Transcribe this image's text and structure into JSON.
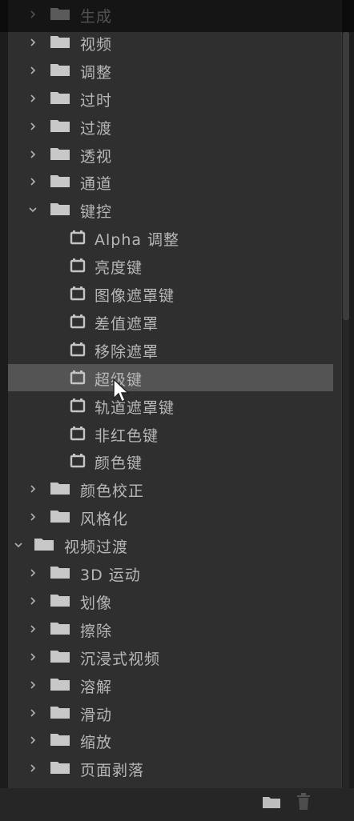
{
  "tree": {
    "items": [
      {
        "label": "生成",
        "state": "collapsed",
        "type": "folder",
        "level": 1
      },
      {
        "label": "视频",
        "state": "collapsed",
        "type": "folder",
        "level": 1
      },
      {
        "label": "调整",
        "state": "collapsed",
        "type": "folder",
        "level": 1
      },
      {
        "label": "过时",
        "state": "collapsed",
        "type": "folder",
        "level": 1
      },
      {
        "label": "过渡",
        "state": "collapsed",
        "type": "folder",
        "level": 1
      },
      {
        "label": "透视",
        "state": "collapsed",
        "type": "folder",
        "level": 1
      },
      {
        "label": "通道",
        "state": "collapsed",
        "type": "folder",
        "level": 1
      },
      {
        "label": "键控",
        "state": "expanded",
        "type": "folder",
        "level": 1
      },
      {
        "label": "Alpha 调整",
        "type": "preset",
        "level": 2
      },
      {
        "label": "亮度键",
        "type": "preset",
        "level": 2
      },
      {
        "label": "图像遮罩键",
        "type": "preset",
        "level": 2
      },
      {
        "label": "差值遮罩",
        "type": "preset",
        "level": 2
      },
      {
        "label": "移除遮罩",
        "type": "preset",
        "level": 2
      },
      {
        "label": "超级键",
        "type": "preset",
        "level": 2,
        "selected": true
      },
      {
        "label": "轨道遮罩键",
        "type": "preset",
        "level": 2
      },
      {
        "label": "非红色键",
        "type": "preset",
        "level": 2
      },
      {
        "label": "颜色键",
        "type": "preset",
        "level": 2
      },
      {
        "label": "颜色校正",
        "state": "collapsed",
        "type": "folder",
        "level": 1
      },
      {
        "label": "风格化",
        "state": "collapsed",
        "type": "folder",
        "level": 1
      },
      {
        "label": "视频过渡",
        "state": "expanded",
        "type": "folder",
        "level": 0
      },
      {
        "label": "3D 运动",
        "state": "collapsed",
        "type": "folder",
        "level": 1
      },
      {
        "label": "划像",
        "state": "collapsed",
        "type": "folder",
        "level": 1
      },
      {
        "label": "擦除",
        "state": "collapsed",
        "type": "folder",
        "level": 1
      },
      {
        "label": "沉浸式视频",
        "state": "collapsed",
        "type": "folder",
        "level": 1
      },
      {
        "label": "溶解",
        "state": "collapsed",
        "type": "folder",
        "level": 1
      },
      {
        "label": "滑动",
        "state": "collapsed",
        "type": "folder",
        "level": 1
      },
      {
        "label": "缩放",
        "state": "collapsed",
        "type": "folder",
        "level": 1
      },
      {
        "label": "页面剥落",
        "state": "collapsed",
        "type": "folder",
        "level": 1
      }
    ]
  },
  "footer": {
    "new_bin_icon": "folder-icon",
    "delete_icon": "trash-icon"
  },
  "colors": {
    "panel": "#2f2f2f",
    "selected_row": "#545454",
    "text": "#b7b7b7",
    "folder": "#c8c8c8"
  }
}
